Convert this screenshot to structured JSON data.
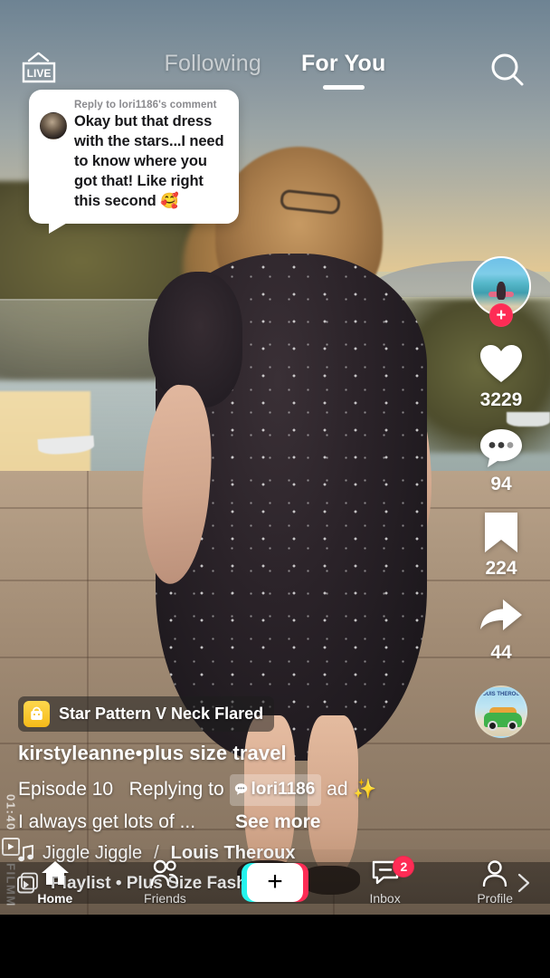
{
  "top_nav": {
    "live_label": "LIVE",
    "live_icon": "live-tv-icon",
    "tabs": [
      {
        "label": "Following",
        "active": false
      },
      {
        "label": "For You",
        "active": true
      }
    ],
    "search_icon": "search-icon"
  },
  "comment_card": {
    "reply_label": "Reply to lori1186's comment",
    "text": "Okay but that dress with the stars...I need to know where you got that! Like right this second 🥰",
    "avatar": "commenter-avatar"
  },
  "action_rail": {
    "avatar": "author-avatar",
    "follow_badge": "+",
    "like": {
      "icon": "heart-icon",
      "count": "3229"
    },
    "comment": {
      "icon": "comment-bubble-icon",
      "count": "94"
    },
    "bookmark": {
      "icon": "bookmark-icon",
      "count": "224"
    },
    "share": {
      "icon": "share-arrow-icon",
      "count": "44"
    },
    "music_disc": {
      "icon": "music-disc-icon",
      "cover_title": "LOUIS THEROUX"
    }
  },
  "caption": {
    "product_tag": {
      "icon": "shopping-bag-icon",
      "name": "Star Pattern V Neck Flared"
    },
    "username": "kirstyleanne•plus size travel",
    "desc_part1": "Episode 10",
    "desc_part2": "Replying to",
    "mention_icon": "mention-bubble-icon",
    "mention": "lori1186",
    "desc_part3": "ad",
    "desc_emoji": "✨",
    "desc_line2": "I always get lots of ...",
    "see_more": "See more",
    "music": {
      "icon": "music-note-icon",
      "title": "Jiggle Jiggle",
      "separator": "/",
      "artist": "Louis Theroux"
    }
  },
  "playlist": {
    "icon": "playlist-icon",
    "text": "Playlist • Plus Size Fashion ❤️",
    "chevron": "chevron-right-icon"
  },
  "watermark": {
    "app": "FILMM",
    "timestamp": "01:40",
    "logo": "filmm-logo-icon"
  },
  "bottom_nav": {
    "items": [
      {
        "label": "Home",
        "icon": "home-icon",
        "active": true
      },
      {
        "label": "Friends",
        "icon": "friends-icon",
        "active": false
      },
      {
        "label": "",
        "icon": "create-plus-icon",
        "active": false
      },
      {
        "label": "Inbox",
        "icon": "inbox-icon",
        "active": false,
        "badge": "2"
      },
      {
        "label": "Profile",
        "icon": "profile-icon",
        "active": false
      }
    ],
    "create_plus": "+"
  },
  "colors": {
    "accent_pink": "#fe2c55",
    "accent_cyan": "#25f4ee",
    "tag_yellow": "#f5ba19",
    "white": "#ffffff"
  }
}
